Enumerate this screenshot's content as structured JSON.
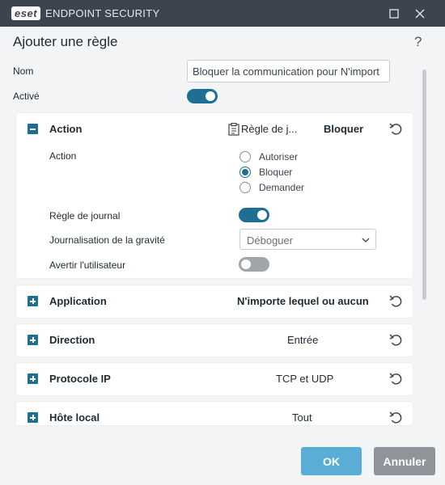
{
  "titlebar": {
    "logo_text": "eset",
    "app_title": "ENDPOINT SECURITY",
    "maximize_icon": "maximize-icon",
    "close_icon": "close-icon"
  },
  "header": {
    "title": "Ajouter une règle",
    "help": "?"
  },
  "form": {
    "name_label": "Nom",
    "name_value": "Bloquer la communication pour N'import",
    "active_label": "Activé",
    "active_on": true
  },
  "action_card": {
    "title": "Action",
    "rule_summary": "Règle de j...",
    "value": "Bloquer",
    "action_label": "Action",
    "options": [
      {
        "label": "Autoriser",
        "checked": false
      },
      {
        "label": "Bloquer",
        "checked": true
      },
      {
        "label": "Demander",
        "checked": false
      }
    ],
    "log_rule_label": "Règle de journal",
    "log_rule_on": true,
    "severity_label": "Journalisation de la gravité",
    "severity_value": "Déboguer",
    "notify_label": "Avertir l'utilisateur",
    "notify_on": false
  },
  "cards": [
    {
      "title": "Application",
      "value": "N'importe lequel ou aucun"
    },
    {
      "title": "Direction",
      "value": "Entrée"
    },
    {
      "title": "Protocole IP",
      "value": "TCP et UDP"
    },
    {
      "title": "Hôte local",
      "value": "Tout"
    }
  ],
  "footer": {
    "ok_label": "OK",
    "cancel_label": "Annuler"
  },
  "colors": {
    "titlebar": "#3c4450",
    "accent": "#1f6f94",
    "ok_button": "#5aaed6",
    "cancel_button": "#8e949a"
  }
}
